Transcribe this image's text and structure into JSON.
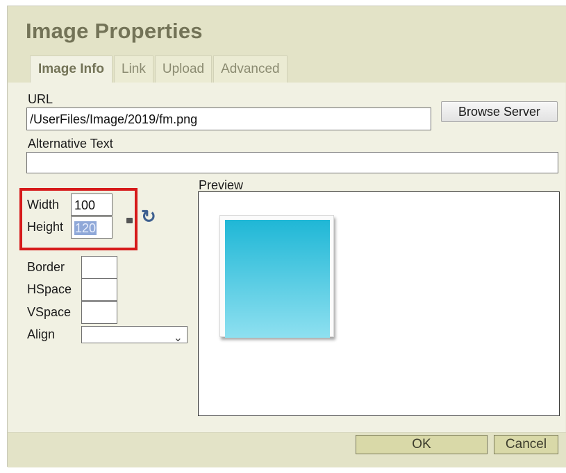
{
  "dialog": {
    "title": "Image Properties",
    "tabs": [
      {
        "label": "Image Info",
        "active": true
      },
      {
        "label": "Link",
        "active": false
      },
      {
        "label": "Upload",
        "active": false
      },
      {
        "label": "Advanced",
        "active": false
      }
    ]
  },
  "url": {
    "label": "URL",
    "value": "/UserFiles/Image/2019/fm.png",
    "browse_button": "Browse Server"
  },
  "alt_text": {
    "label": "Alternative Text",
    "value": ""
  },
  "dimensions": {
    "width_label": "Width",
    "width_value": "100",
    "height_label": "Height",
    "height_value": "120"
  },
  "layout_fields": {
    "border_label": "Border",
    "border_value": "",
    "hspace_label": "HSpace",
    "hspace_value": "",
    "vspace_label": "VSpace",
    "vspace_value": "",
    "align_label": "Align",
    "align_value": ""
  },
  "preview": {
    "label": "Preview",
    "image_colors": [
      "#1fb7d6",
      "#8ee0f0"
    ]
  },
  "footer": {
    "ok_label": "OK",
    "cancel_label": "Cancel"
  },
  "icons": {
    "lock": "lock-ratio-icon",
    "reset": "reset-size-icon"
  },
  "colors": {
    "title": "#737357",
    "header_bg": "#e3e3c7",
    "highlight": "#d61a1a",
    "footer_button_bg": "#d9d9a8"
  }
}
